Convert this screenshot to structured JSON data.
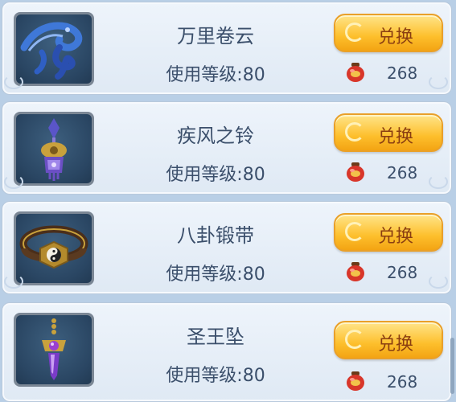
{
  "exchange_list": {
    "button_label": "兑换",
    "level_prefix": "使用等级:",
    "items": [
      {
        "name": "万里卷云",
        "level_text": "使用等级:80",
        "price": "268",
        "icon": "blue-ribbon-scarf-icon"
      },
      {
        "name": "疾风之铃",
        "level_text": "使用等级:80",
        "price": "268",
        "icon": "purple-bell-pendant-icon"
      },
      {
        "name": "八卦锻带",
        "level_text": "使用等级:80",
        "price": "268",
        "icon": "bagua-belt-icon"
      },
      {
        "name": "圣王坠",
        "level_text": "使用等级:80",
        "price": "268",
        "icon": "purple-gem-pendant-icon"
      }
    ]
  },
  "currency_icon": "red-jar-icon",
  "colors": {
    "panel_bg": "#b9cfe6",
    "row_bg": "#eef4fb",
    "text": "#3b4f6b",
    "button": "#fdbf2c",
    "button_text": "#8a3e11"
  }
}
